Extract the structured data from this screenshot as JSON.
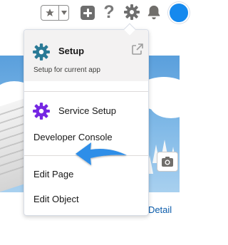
{
  "topbar": {
    "favorites_icon": "star-icon",
    "favorites_menu_icon": "caret-down-icon",
    "add_icon": "plus-icon",
    "help_icon": "question-icon",
    "help_glyph": "?",
    "setup_icon": "gear-icon",
    "notifications_icon": "bell-icon",
    "avatar_icon": "user-avatar"
  },
  "menu": {
    "header": {
      "title": "Setup",
      "subtitle": "Setup for current app",
      "icon": "gear-icon",
      "open_new_icon": "external-link-icon"
    },
    "items": [
      {
        "label": "Service Setup",
        "icon": "gear-icon"
      },
      {
        "label": "Developer Console"
      },
      {
        "label": "Edit Page"
      },
      {
        "label": "Edit Object"
      }
    ]
  },
  "page": {
    "detail_link": "r Detail",
    "camera_icon": "camera-icon"
  },
  "annotation": {
    "icon": "arrow-icon",
    "color": "#2f8ee8"
  },
  "colors": {
    "accent_purple": "#7526e3",
    "setup_teal": "#2a7a96",
    "banner_blue": "#5a9fdc"
  }
}
